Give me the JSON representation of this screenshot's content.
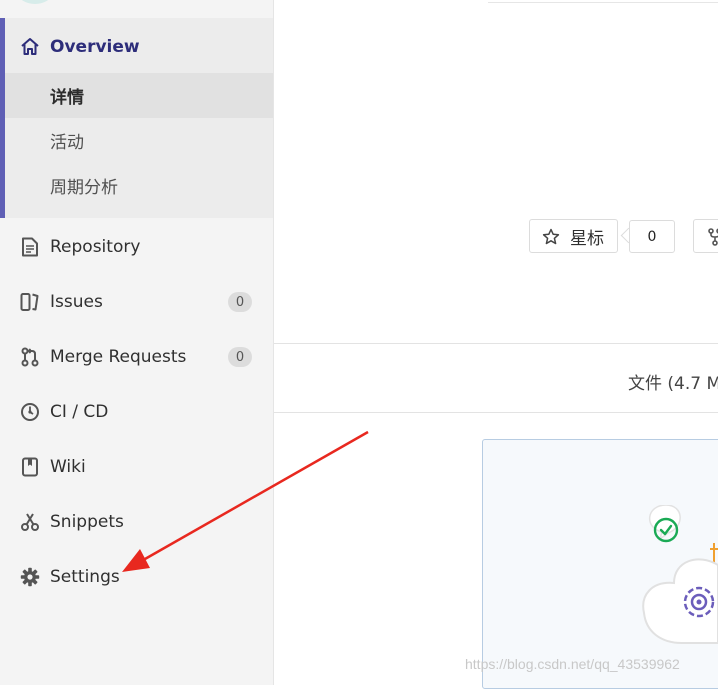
{
  "sidebar": {
    "overview": {
      "label": "Overview",
      "sub_items": [
        {
          "label": "详情",
          "active": true
        },
        {
          "label": "活动",
          "active": false
        },
        {
          "label": "周期分析",
          "active": false
        }
      ]
    },
    "items": [
      {
        "label": "Repository",
        "icon": "repository-icon"
      },
      {
        "label": "Issues",
        "icon": "issues-icon",
        "badge": "0"
      },
      {
        "label": "Merge Requests",
        "icon": "merge-request-icon",
        "badge": "0"
      },
      {
        "label": "CI / CD",
        "icon": "ci-cd-icon"
      },
      {
        "label": "Wiki",
        "icon": "wiki-icon"
      },
      {
        "label": "Snippets",
        "icon": "snippets-icon"
      },
      {
        "label": "Settings",
        "icon": "gear-icon"
      }
    ]
  },
  "main": {
    "star": {
      "label": "星标",
      "count": "0"
    },
    "file_info": "文件 (4.7 M",
    "watermark": "https://blog.csdn.net/qq_43539962"
  },
  "colors": {
    "accent": "#5f5fb5",
    "annotation_arrow": "#e8281f",
    "success": "#1aaa55"
  }
}
